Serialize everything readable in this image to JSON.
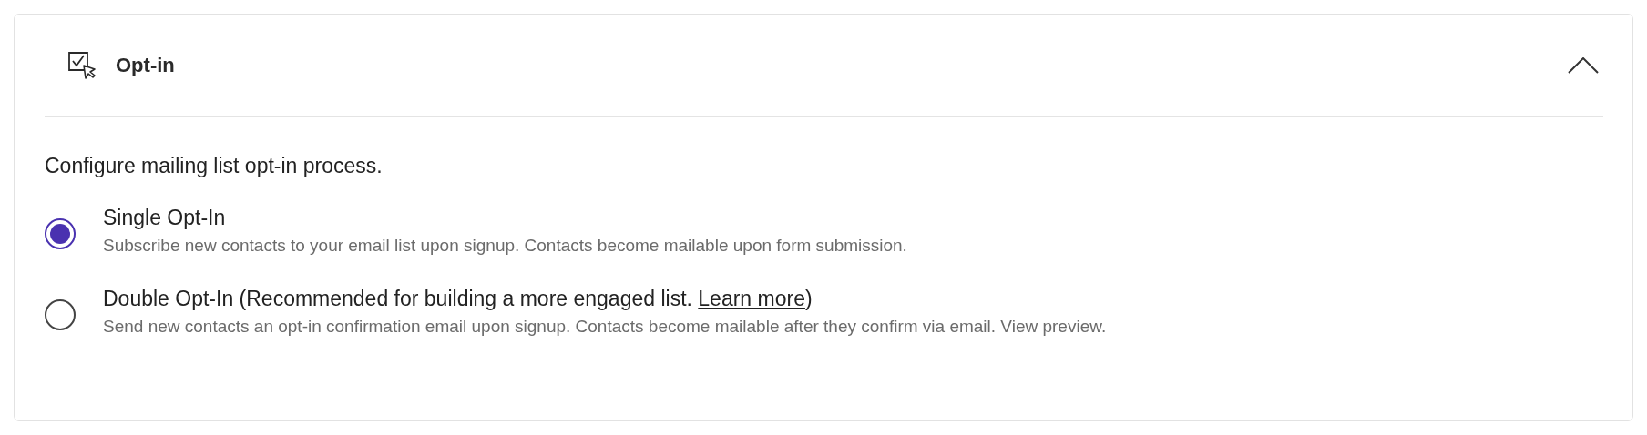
{
  "panel": {
    "title": "Opt-in",
    "expanded": true,
    "description": "Configure mailing list opt-in process.",
    "options": [
      {
        "label": "Single Opt-In",
        "selected": true,
        "hint": "Subscribe new contacts to your email list upon signup. Contacts become mailable upon form submission."
      },
      {
        "label": "Double Opt-In (Recommended for building a more engaged list. ",
        "link": "Learn more",
        "label_end": ")",
        "selected": false,
        "hint": "Send new contacts an opt-in confirmation email upon signup. Contacts become mailable after they confirm via email. View preview."
      }
    ]
  }
}
